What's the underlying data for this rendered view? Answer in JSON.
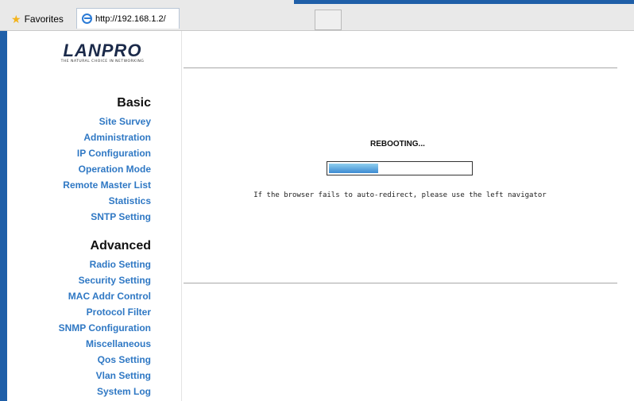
{
  "browser": {
    "favorites_label": "Favorites",
    "tab_url": "http://192.168.1.2/"
  },
  "sidebar": {
    "logo_text": "LANPRO",
    "logo_tagline": "THE NATURAL CHOICE IN NETWORKING",
    "basic_title": "Basic",
    "basic_items": [
      "Site Survey",
      "Administration",
      "IP Configuration",
      "Operation Mode",
      "Remote Master List",
      "Statistics",
      "SNTP Setting"
    ],
    "advanced_title": "Advanced",
    "advanced_items": [
      "Radio Setting",
      "Security Setting",
      "MAC Addr Control",
      "Protocol Filter",
      "SNMP Configuration",
      "Miscellaneous",
      "Qos Setting",
      "Vlan Setting",
      "System Log"
    ]
  },
  "main": {
    "status": "REBOOTING...",
    "progress_percent": 35,
    "note": "If the browser fails to auto-redirect, please use the left navigator"
  }
}
